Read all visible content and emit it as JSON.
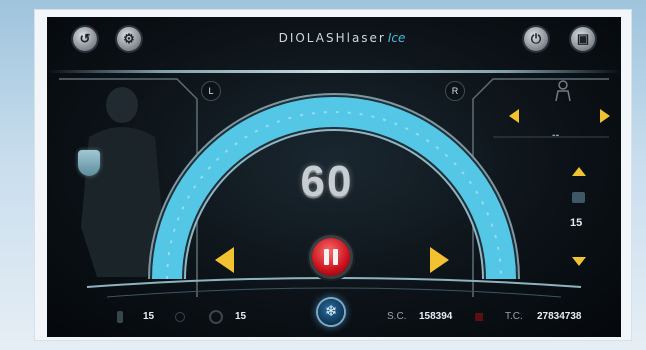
{
  "header": {
    "brand": "DIOLASHlaser",
    "brand_suffix": "Ice",
    "back_icon": "back-arrow-icon",
    "settings_icon": "gear-icon",
    "power_icon": "power-icon",
    "save_icon": "disk-icon"
  },
  "gauge": {
    "value": "60",
    "left_label": "L",
    "right_label": "R",
    "fill_level": 0.6
  },
  "right_panel": {
    "value": "15",
    "dash": "--"
  },
  "bottom_bar": {
    "left_value_1": "15",
    "left_value_2": "15",
    "sc_label": "S.C.",
    "sc_value": "158394",
    "tc_label": "T.C.",
    "tc_value": "27834738"
  },
  "colors": {
    "accent_cyan": "#55c7e6",
    "arrow_yellow": "#f2c230",
    "pause_red": "#d0121e"
  }
}
